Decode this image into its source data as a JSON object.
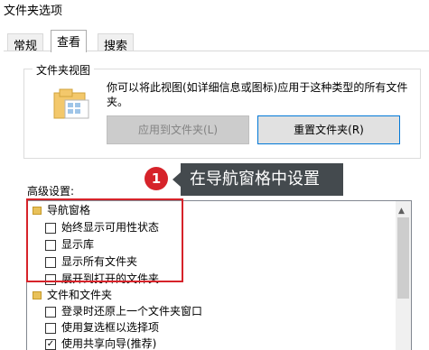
{
  "window": {
    "title": "文件夹选项"
  },
  "tabs": [
    {
      "label": "常规"
    },
    {
      "label": "查看"
    },
    {
      "label": "搜索"
    }
  ],
  "folder_view": {
    "group_label": "文件夹视图",
    "description": "你可以将此视图(如详细信息或图标)应用于这种类型的所有文件夹。",
    "apply_button": "应用到文件夹(L)",
    "reset_button": "重置文件夹(R)"
  },
  "advanced": {
    "label": "高级设置:",
    "tree": [
      {
        "type": "node",
        "label": "导航窗格"
      },
      {
        "type": "check",
        "label": "始终显示可用性状态",
        "checked": false
      },
      {
        "type": "check",
        "label": "显示库",
        "checked": false
      },
      {
        "type": "check",
        "label": "显示所有文件夹",
        "checked": false
      },
      {
        "type": "check",
        "label": "展开到打开的文件夹",
        "checked": false
      },
      {
        "type": "node",
        "label": "文件和文件夹"
      },
      {
        "type": "check",
        "label": "登录时还原上一个文件夹窗口",
        "checked": false
      },
      {
        "type": "check",
        "label": "使用复选框以选择项",
        "checked": false
      },
      {
        "type": "check",
        "label": "使用共享向导(推荐)",
        "checked": true
      }
    ]
  },
  "annotation": {
    "number": "1",
    "text": "在导航窗格中设置",
    "color": "#d6232a"
  }
}
